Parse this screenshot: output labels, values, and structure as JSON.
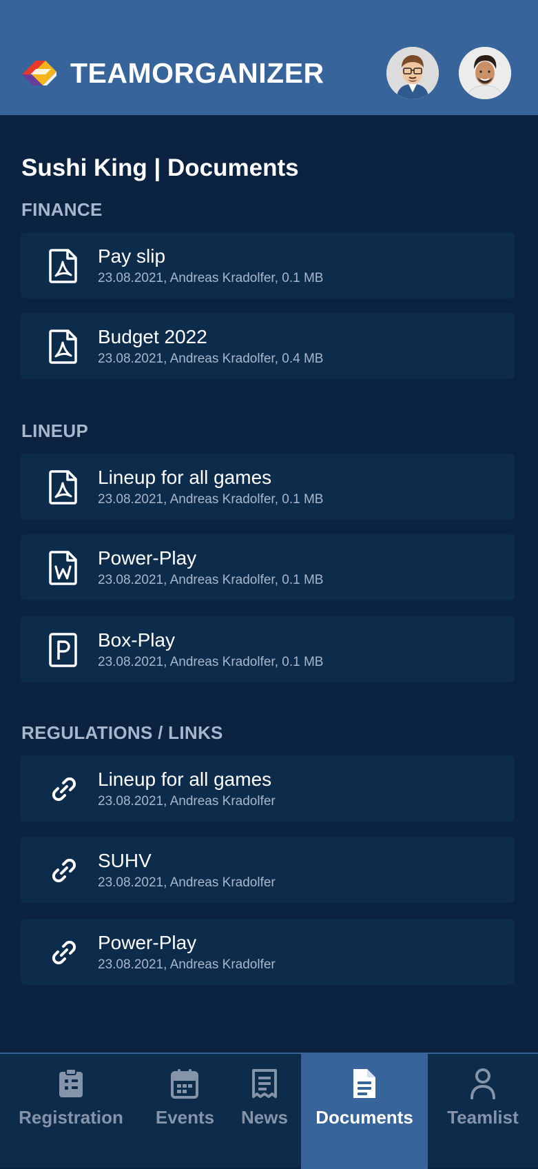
{
  "header": {
    "brand": "TEAMORGANIZER",
    "logo_icon": "teamorganizer-logo",
    "avatars": [
      "avatar-cartoon-user",
      "avatar-photo-user"
    ]
  },
  "page": {
    "title": "Sushi King | Documents"
  },
  "sections": [
    {
      "title": "FINANCE",
      "items": [
        {
          "title": "Pay slip",
          "meta": "23.08.2021, Andreas Kradolfer, 0.1 MB",
          "icon": "pdf-file-icon"
        },
        {
          "title": "Budget 2022",
          "meta": "23.08.2021, Andreas Kradolfer, 0.4 MB",
          "icon": "pdf-file-icon"
        }
      ]
    },
    {
      "title": "LINEUP",
      "items": [
        {
          "title": "Lineup for all games",
          "meta": "23.08.2021, Andreas Kradolfer, 0.1 MB",
          "icon": "pdf-file-icon"
        },
        {
          "title": "Power-Play",
          "meta": "23.08.2021, Andreas Kradolfer, 0.1 MB",
          "icon": "word-file-icon"
        },
        {
          "title": "Box-Play",
          "meta": "23.08.2021, Andreas Kradolfer, 0.1 MB",
          "icon": "powerpoint-file-icon"
        }
      ]
    },
    {
      "title": "REGULATIONS / LINKS",
      "items": [
        {
          "title": "Lineup for all games",
          "meta": "23.08.2021, Andreas Kradolfer",
          "icon": "link-icon"
        },
        {
          "title": "SUHV",
          "meta": "23.08.2021, Andreas Kradolfer",
          "icon": "link-icon"
        },
        {
          "title": "Power-Play",
          "meta": "23.08.2021, Andreas Kradolfer",
          "icon": "link-icon"
        }
      ]
    }
  ],
  "nav": {
    "items": [
      {
        "label": "Registration",
        "icon": "clipboard-icon",
        "active": false
      },
      {
        "label": "Events",
        "icon": "calendar-icon",
        "active": false
      },
      {
        "label": "News",
        "icon": "news-icon",
        "active": false
      },
      {
        "label": "Documents",
        "icon": "document-icon",
        "active": true
      },
      {
        "label": "Teamlist",
        "icon": "person-icon",
        "active": false
      }
    ]
  },
  "colors": {
    "header_bg": "#37649a",
    "page_bg": "#0b2240",
    "card_bg": "#0d2b4a",
    "section_title": "#a8b7cb",
    "nav_active_bg": "#37649a",
    "nav_inactive_label": "#8594a8"
  }
}
